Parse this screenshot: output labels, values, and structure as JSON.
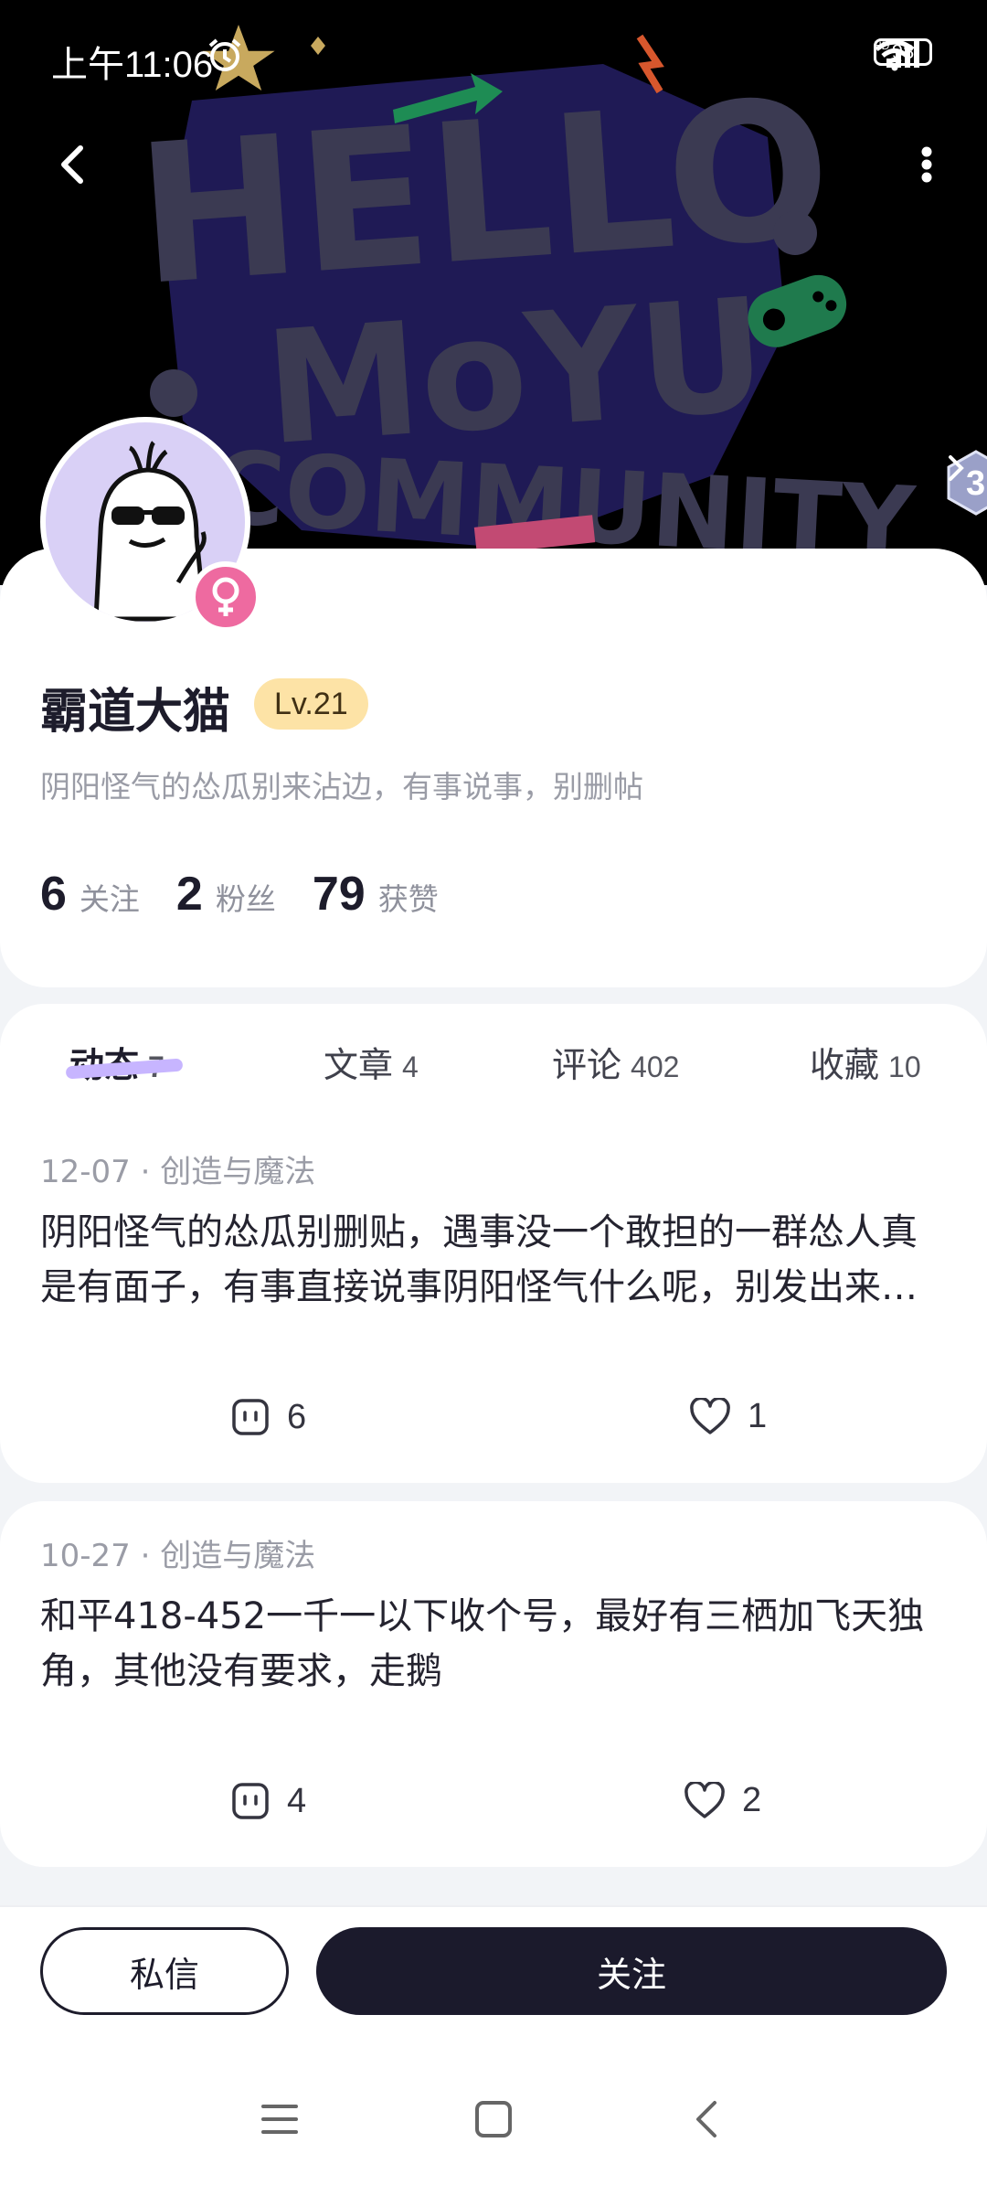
{
  "status_bar": {
    "time": "上午11:06",
    "battery": "98"
  },
  "header": {
    "back_icon": "chevron-left-icon",
    "more_icon": "vertical-dots-icon",
    "banner_text_lines": [
      "HELLO",
      "MoYU",
      "COMMUNITY"
    ]
  },
  "profile": {
    "name": "霸道大猫",
    "level": "Lv.21",
    "bio": "阴阳怪气的怂瓜别来沾边，有事说事，别删帖",
    "gender_icon": "female-icon",
    "stats": [
      {
        "value": "6",
        "label": "关注"
      },
      {
        "value": "2",
        "label": "粉丝"
      },
      {
        "value": "79",
        "label": "获赞"
      }
    ]
  },
  "tabs": [
    {
      "label": "动态",
      "count": "7",
      "active": true
    },
    {
      "label": "文章",
      "count": "4"
    },
    {
      "label": "评论",
      "count": "402"
    },
    {
      "label": "收藏",
      "count": "10"
    }
  ],
  "posts": [
    {
      "meta": "12-07 · 创造与魔法",
      "text": "阴阳怪气的怂瓜别删贴，遇事没一个敢担的一群怂人真是有面子，有事直接说事阴阳怪气什么呢，别发出来又删掉，一群怂瓜",
      "comments": "6",
      "likes": "1"
    },
    {
      "meta": "10-27 · 创造与魔法",
      "text": "和平418-452一千一以下收个号，最好有三栖加飞天独角，其他没有要求，走鹅",
      "comments": "4",
      "likes": "2"
    }
  ],
  "actions": {
    "message": "私信",
    "follow": "关注"
  },
  "colors": {
    "accent_dark": "#1b1a2c",
    "level_bg": "#fde3a6",
    "gender_pink": "#ee6aa0",
    "tab_underline": "#c7b5ff"
  }
}
